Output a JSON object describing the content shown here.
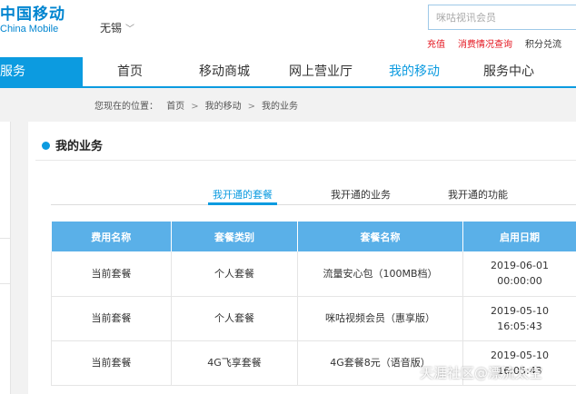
{
  "header": {
    "logo_cn": "中国移动",
    "logo_en": "China Mobile",
    "city": "无锡",
    "search_placeholder": "咪咕视讯会员",
    "quick_links": [
      "充值",
      "消费情况查询",
      "积分兑流"
    ]
  },
  "nav": {
    "service_label": "服务",
    "items": [
      "首页",
      "移动商城",
      "网上营业厅",
      "我的移动",
      "服务中心"
    ],
    "active_index": 3
  },
  "breadcrumb": {
    "prefix": "您现在的位置：",
    "items": [
      "首页",
      "我的移动",
      "我的业务"
    ],
    "separator": ">"
  },
  "main": {
    "title": "我的业务",
    "tabs": [
      "我开通的套餐",
      "我开通的业务",
      "我开通的功能"
    ],
    "active_tab": 0,
    "columns": [
      "费用名称",
      "套餐类别",
      "套餐名称",
      "启用日期"
    ],
    "rows": [
      [
        "当前套餐",
        "个人套餐",
        "流量安心包（100MB档）",
        "2019-06-01\n00:00:00"
      ],
      [
        "当前套餐",
        "个人套餐",
        "咪咕视频会员（惠享版）",
        "2019-05-10\n16:05:43"
      ],
      [
        "当前套餐",
        "4G飞享套餐",
        "4G套餐8元（语音版）",
        "2019-05-10\n16:05:43"
      ]
    ]
  },
  "watermark": "天涯社区@漂流太空",
  "colors": {
    "brand_blue": "#0c9be0",
    "table_header": "#5ab0e8",
    "link_red": "#e4151f"
  }
}
